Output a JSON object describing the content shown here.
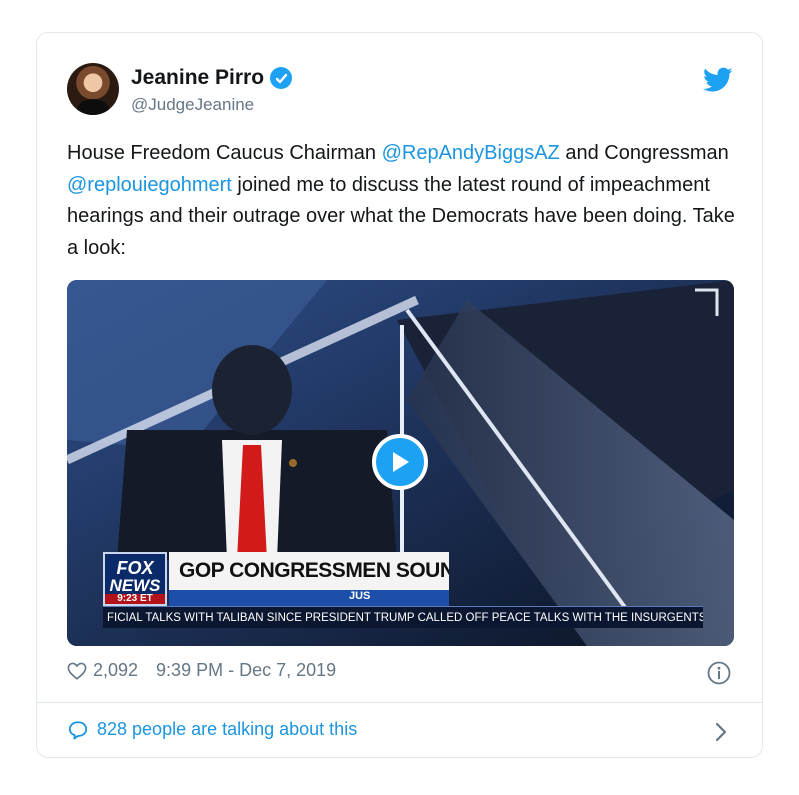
{
  "author": {
    "name": "Jeanine Pirro",
    "handle": "@JudgeJeanine"
  },
  "tweet": {
    "segments": [
      {
        "text": "House Freedom Caucus Chairman ",
        "type": "text"
      },
      {
        "text": "@RepAndyBiggsAZ",
        "type": "mention"
      },
      {
        "text": " and Congressman ",
        "type": "text"
      },
      {
        "text": "@replouiegohmert",
        "type": "mention"
      },
      {
        "text": " joined me to discuss the latest round of impeachment hearings and their outrage over what the Democrats have been doing. Take a look:",
        "type": "text"
      }
    ]
  },
  "media": {
    "logo_top": "FOX",
    "logo_bottom": "NEWS",
    "logo_time": "9:23 ET",
    "headline": "GOP CONGRESSMEN SOUND",
    "subheadline": "JUS",
    "ticker": "FICIAL TALKS WITH TALIBAN SINCE PRESIDENT TRUMP CALLED OFF PEACE TALKS WITH THE INSURGENTS IN S"
  },
  "meta": {
    "likes": "2,092",
    "timestamp": "9:39 PM - Dec 7, 2019"
  },
  "conversation": {
    "label": "828 people are talking about this"
  },
  "colors": {
    "twitter_blue": "#1da1f2",
    "link_blue": "#1b95e0",
    "secondary_text": "#657786"
  },
  "icons": [
    "verified-badge-icon",
    "twitter-bird-icon",
    "play-icon",
    "heart-icon",
    "info-icon",
    "comment-bubble-icon",
    "chevron-right-icon"
  ]
}
